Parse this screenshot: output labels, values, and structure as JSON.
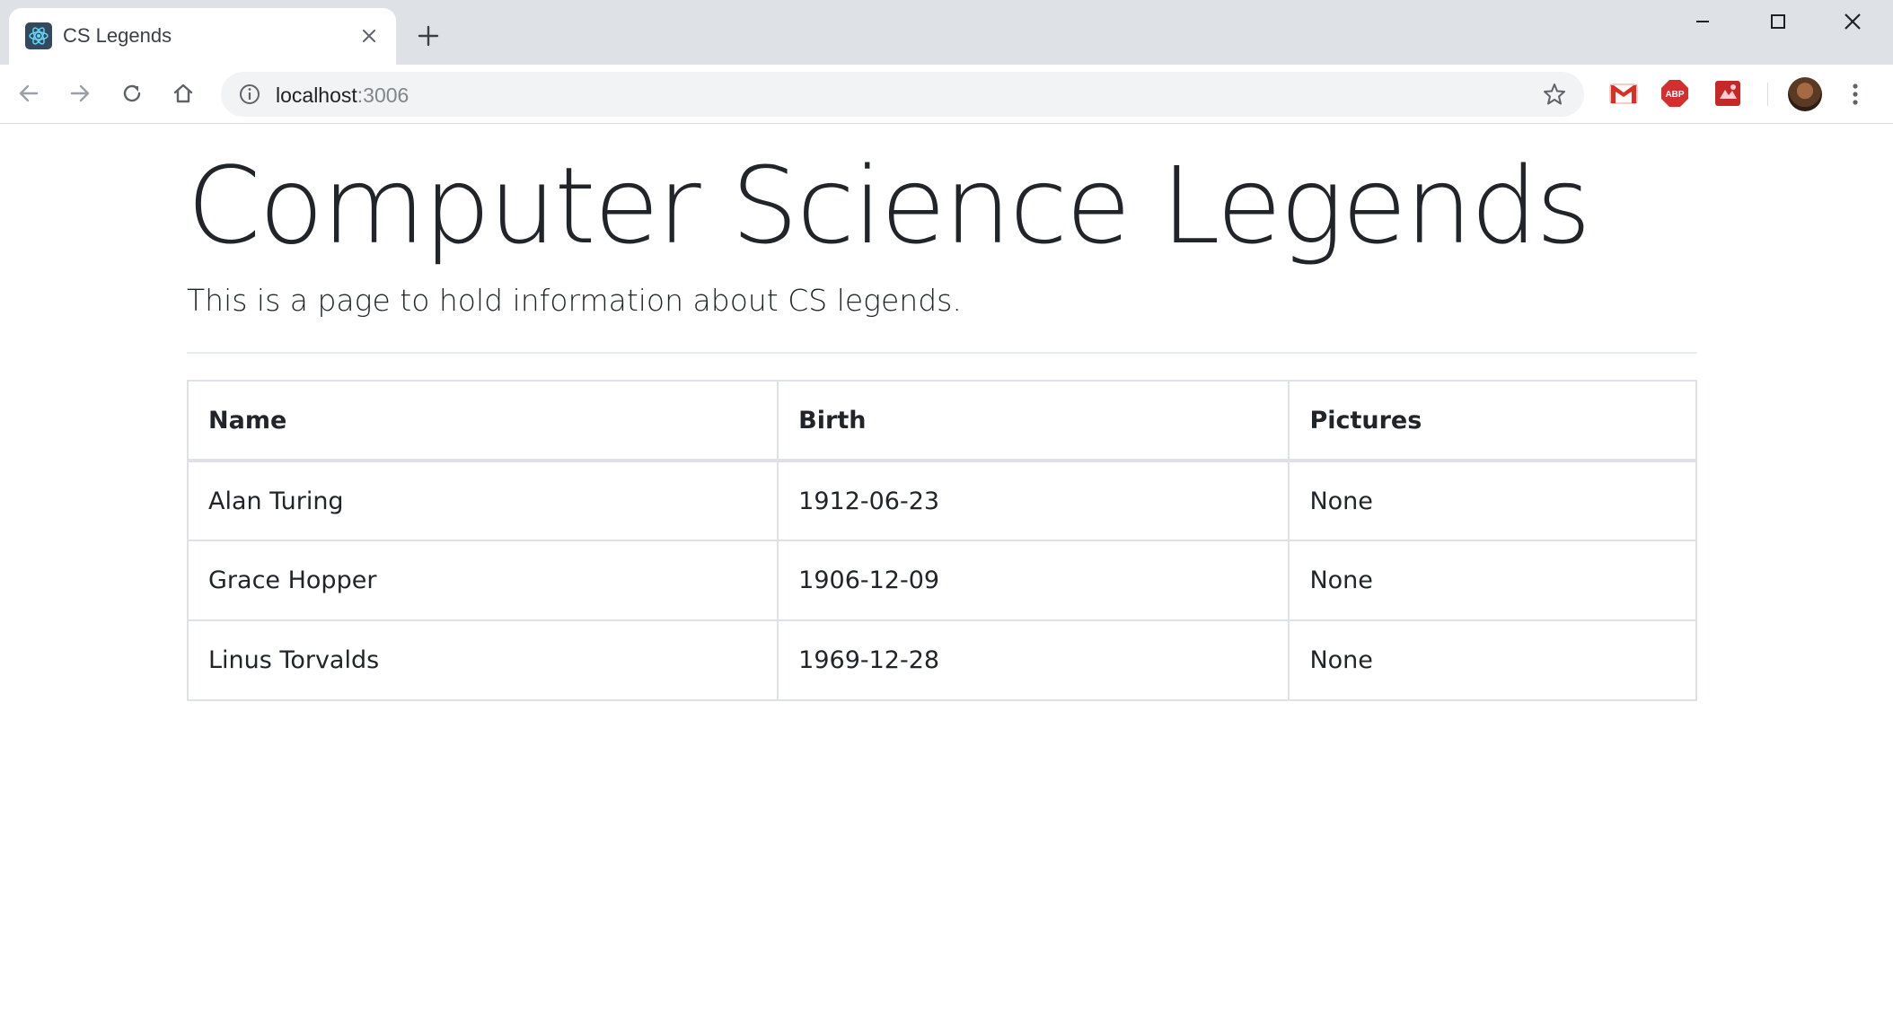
{
  "browser": {
    "tab": {
      "title": "CS Legends"
    },
    "omnibox": {
      "host": "localhost",
      "port": ":3006"
    },
    "icons": {
      "back": "arrow-left-icon",
      "forward": "arrow-right-icon",
      "reload": "reload-icon",
      "home": "home-icon",
      "site_info": "info-icon",
      "bookmark": "star-icon",
      "menu": "kebab-menu-icon"
    },
    "extensions": [
      {
        "name": "gmail-icon",
        "color": "#d93025"
      },
      {
        "name": "adblock-plus-icon",
        "color": "#d32f2f",
        "label": "ABP"
      },
      {
        "name": "extension-red-icon",
        "color": "#c62828"
      }
    ]
  },
  "page": {
    "title": "Computer Science Legends",
    "lead": "This is a page to hold information about CS legends.",
    "table": {
      "columns": [
        "Name",
        "Birth",
        "Pictures"
      ],
      "rows": [
        [
          "Alan Turing",
          "1912-06-23",
          "None"
        ],
        [
          "Grace Hopper",
          "1906-12-09",
          "None"
        ],
        [
          "Linus Torvalds",
          "1969-12-28",
          "None"
        ]
      ]
    }
  },
  "colors": {
    "text": "#212529",
    "border": "#dee2e6",
    "chrome_bg": "#dee1e6",
    "omnibox_bg": "#f1f3f4"
  }
}
